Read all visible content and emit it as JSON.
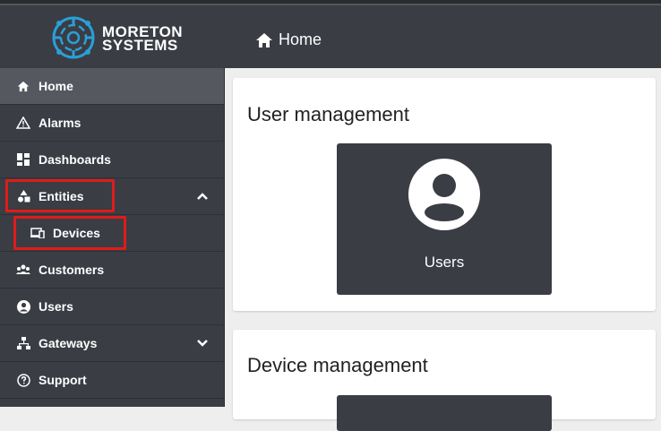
{
  "app": {
    "brand_line1": "MORETON",
    "brand_line2": "SYSTEMS"
  },
  "header": {
    "breadcrumb": "Home"
  },
  "sidebar": {
    "items": [
      {
        "label": "Home",
        "icon": "home-icon",
        "active": true
      },
      {
        "label": "Alarms",
        "icon": "alarm-warning-icon"
      },
      {
        "label": "Dashboards",
        "icon": "dashboard-icon"
      },
      {
        "label": "Entities",
        "icon": "entities-icon",
        "expanded": true,
        "highlighted": true
      },
      {
        "label": "Devices",
        "icon": "devices-icon",
        "sub": true,
        "highlighted": true
      },
      {
        "label": "Customers",
        "icon": "customers-icon"
      },
      {
        "label": "Users",
        "icon": "user-icon"
      },
      {
        "label": "Gateways",
        "icon": "gateways-icon",
        "expanded": false
      },
      {
        "label": "Support",
        "icon": "help-icon"
      }
    ]
  },
  "main": {
    "sections": [
      {
        "title": "User management",
        "tile": "Users"
      },
      {
        "title": "Device management"
      }
    ]
  },
  "colors": {
    "sidebar_bg": "#3a3d44",
    "active_bg": "#55585f",
    "highlight": "#e01b1b",
    "logo_blue": "#2a9fd8"
  }
}
